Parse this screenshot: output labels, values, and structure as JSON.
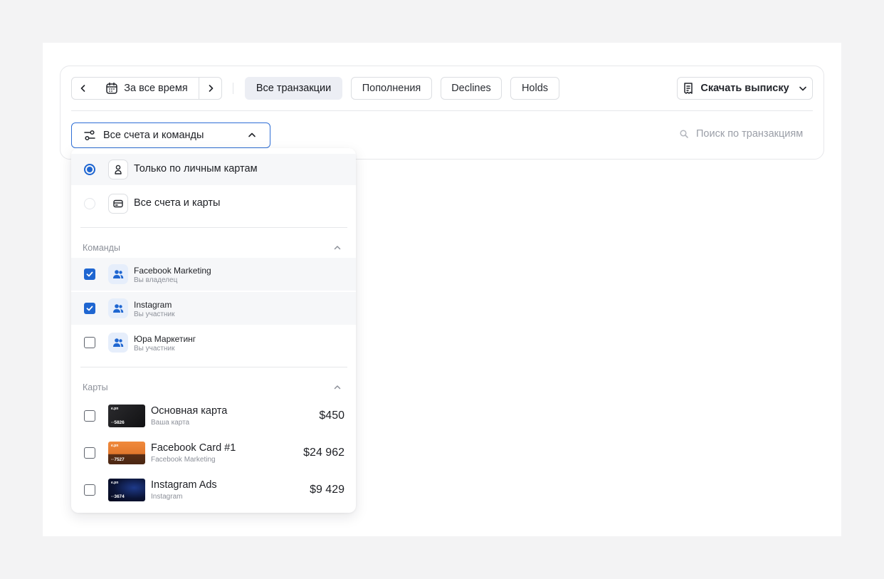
{
  "colors": {
    "accent": "#1f66d1",
    "page_bg": "#f3f3f4"
  },
  "toolbar": {
    "period_label": "За все время",
    "tabs": [
      "Все транзакции",
      "Пополнения",
      "Declines",
      "Holds"
    ],
    "active_tab": "Все транзакции",
    "download_label": "Скачать выписку"
  },
  "filter": {
    "selected_label": "Все счета и команды",
    "search_placeholder": "Поиск по транзакциям"
  },
  "dropdown": {
    "scope_options": [
      {
        "label": "Только по личным картам",
        "selected": true,
        "icon": "person-icon"
      },
      {
        "label": "Все счета и карты",
        "selected": false,
        "icon": "card-icon"
      }
    ],
    "teams_title": "Команды",
    "teams": [
      {
        "name": "Facebook Marketing",
        "role": "Вы владелец",
        "checked": true
      },
      {
        "name": "Instagram",
        "role": "Вы участник",
        "checked": true
      },
      {
        "name": "Юра Маркетинг",
        "role": "Вы участник",
        "checked": false
      }
    ],
    "cards_title": "Карты",
    "cards": [
      {
        "name": "Основная карта",
        "owner": "Ваша карта",
        "amount": "$450",
        "last4": "··5826",
        "checked": false,
        "logo": "e.pn"
      },
      {
        "name": "Facebook Card #1",
        "owner": "Facebook Marketing",
        "amount": "$24 962",
        "last4": "··7527",
        "checked": false,
        "logo": "e.pn"
      },
      {
        "name": "Instagram Ads",
        "owner": "Instagram",
        "amount": "$9 429",
        "last4": "··3674",
        "checked": false,
        "logo": "e.pn"
      }
    ]
  }
}
